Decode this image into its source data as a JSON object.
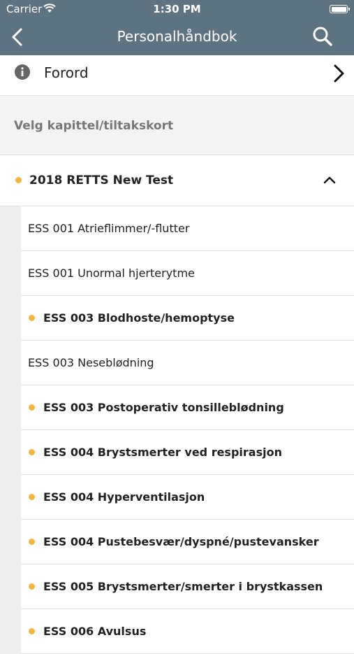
{
  "status_bar": {
    "carrier": "Carrier",
    "time": "1:30 PM"
  },
  "nav": {
    "title": "Personalhåndbok"
  },
  "forord": {
    "label": "Forord"
  },
  "section": {
    "label": "Velg kapittel/tiltakskort"
  },
  "group": {
    "label": "2018 RETTS New Test"
  },
  "colors": {
    "accent_dot": "#f2b73d",
    "nav_bg": "#5e7382"
  },
  "items": [
    {
      "label": "ESS 001 Atrieflimmer/-flutter",
      "highlight": false
    },
    {
      "label": "ESS 001 Unormal hjerterytme",
      "highlight": false
    },
    {
      "label": "ESS 003 Blodhoste/hemoptyse",
      "highlight": true
    },
    {
      "label": "ESS 003 Neseblødning",
      "highlight": false
    },
    {
      "label": "ESS 003 Postoperativ tonsilleblødning",
      "highlight": true
    },
    {
      "label": "ESS 004 Brystsmerter ved respirasjon",
      "highlight": true
    },
    {
      "label": "ESS 004 Hyperventilasjon",
      "highlight": true
    },
    {
      "label": "ESS 004 Pustebesvær/dyspné/pustevansker",
      "highlight": true
    },
    {
      "label": "ESS 005 Brystsmerter/smerter i brystkassen",
      "highlight": true
    },
    {
      "label": "ESS 006 Avulsus",
      "highlight": true
    }
  ]
}
